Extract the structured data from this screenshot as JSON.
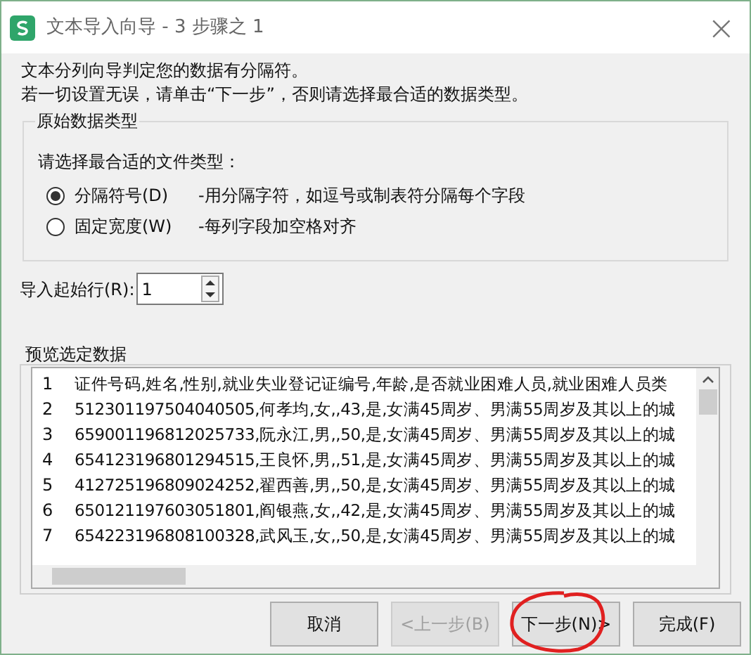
{
  "window": {
    "title": "文本导入向导 - 3 步骤之 1",
    "close": "×"
  },
  "intro": [
    "文本分列向导判定您的数据有分隔符。",
    "若一切设置无误，请单击“下一步”，否则请选择最合适的数据类型。"
  ],
  "group": {
    "title": "原始数据类型",
    "prompt": "请选择最合适的文件类型：",
    "options": [
      {
        "label": "分隔符号(D)",
        "description": "-用分隔字符，如逗号或制表符分隔每个字段",
        "selected": true
      },
      {
        "label": "固定宽度(W)",
        "description": "-每列字段加空格对齐",
        "selected": false
      }
    ]
  },
  "start_row": {
    "label": "导入起始行(R):",
    "value": "1"
  },
  "preview": {
    "title": "预览选定数据",
    "rows": [
      {
        "number": "1",
        "text": "证件号码,姓名,性别,就业失业登记证编号,年龄,是否就业困难人员,就业困难人员类"
      },
      {
        "number": "2",
        "text": "512301197504040505,何孝均,女,,43,是,女满45周岁、男满55周岁及其以上的城"
      },
      {
        "number": "3",
        "text": "659001196812025733,阮永江,男,,50,是,女满45周岁、男满55周岁及其以上的城"
      },
      {
        "number": "4",
        "text": "654123196801294515,王良怀,男,,51,是,女满45周岁、男满55周岁及其以上的城"
      },
      {
        "number": "5",
        "text": "412725196809024252,翟西善,男,,50,是,女满45周岁、男满55周岁及其以上的城"
      },
      {
        "number": "6",
        "text": "650121197603051801,阎银燕,女,,42,是,女满45周岁、男满55周岁及其以上的城"
      },
      {
        "number": "7",
        "text": "654223196808100328,武风玉,女,,50,是,女满45周岁、男满55周岁及其以上的城"
      }
    ]
  },
  "buttons": [
    {
      "label": "取消",
      "disabled": false
    },
    {
      "label": "<上一步(B)",
      "disabled": true
    },
    {
      "label": "下一步(N)>",
      "disabled": false
    },
    {
      "label": "完成(F)",
      "disabled": false
    }
  ]
}
